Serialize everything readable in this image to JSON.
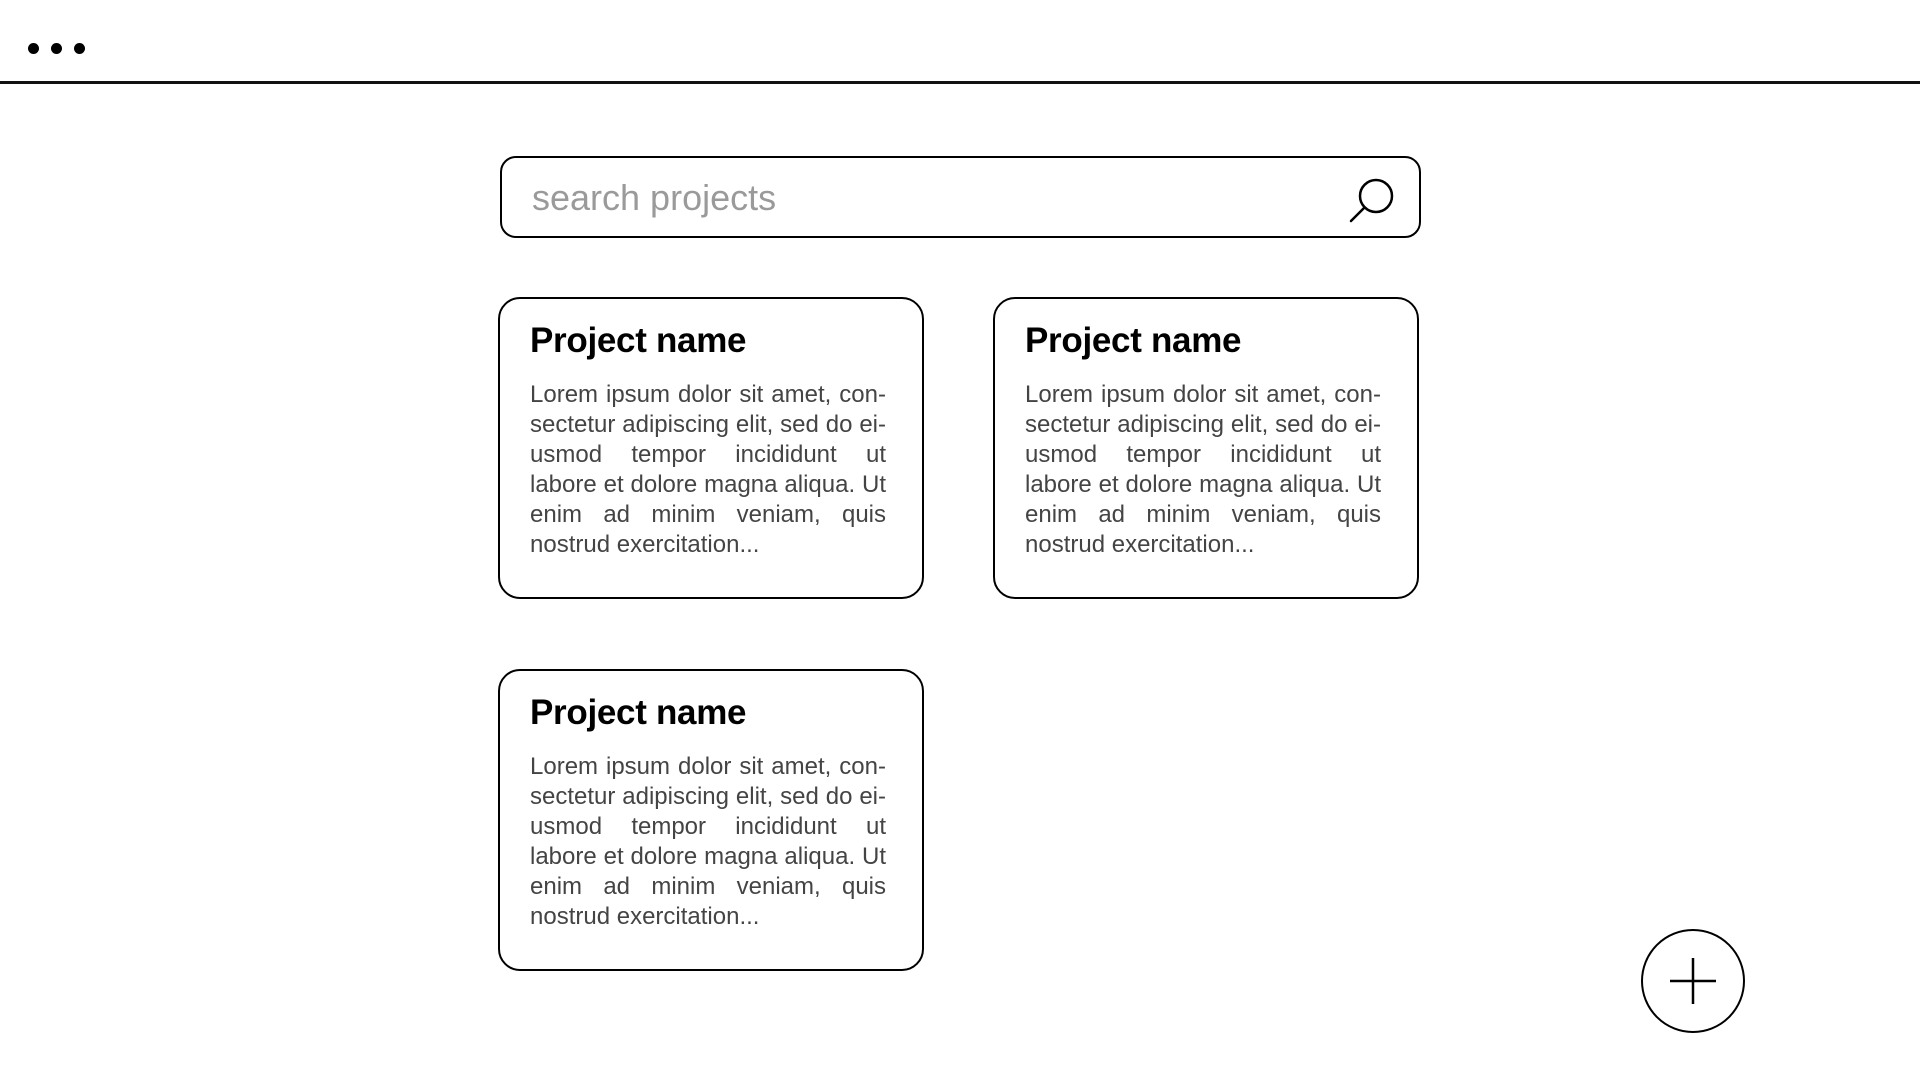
{
  "topbar": {
    "menu_icon": "more-horizontal-icon"
  },
  "search": {
    "placeholder": "search projects",
    "value": "",
    "icon": "search-icon"
  },
  "projects": [
    {
      "name": "Project name",
      "description": "Lorem ipsum dolor sit amet, con-sectetur adipiscing elit, sed do ei-usmod tempor incididunt ut labore et dolore magna aliqua. Ut enim ad minim veniam, quis nostrud exercitation..."
    },
    {
      "name": "Project name",
      "description": "Lorem ipsum dolor sit amet, con-sectetur adipiscing elit, sed do ei-usmod tempor incididunt ut labore et dolore magna aliqua. Ut enim ad minim veniam, quis nostrud exercitation..."
    },
    {
      "name": "Project name",
      "description": "Lorem ipsum dolor sit amet, con-sectetur adipiscing elit, sed do ei-usmod tempor incididunt ut labore et dolore magna aliqua. Ut enim ad minim veniam, quis nostrud exercitation..."
    }
  ],
  "fab": {
    "icon": "plus-circle-icon"
  },
  "colors": {
    "background": "#ffffff",
    "stroke": "#000000",
    "body_text": "#444444",
    "placeholder": "#9a9a9a"
  }
}
